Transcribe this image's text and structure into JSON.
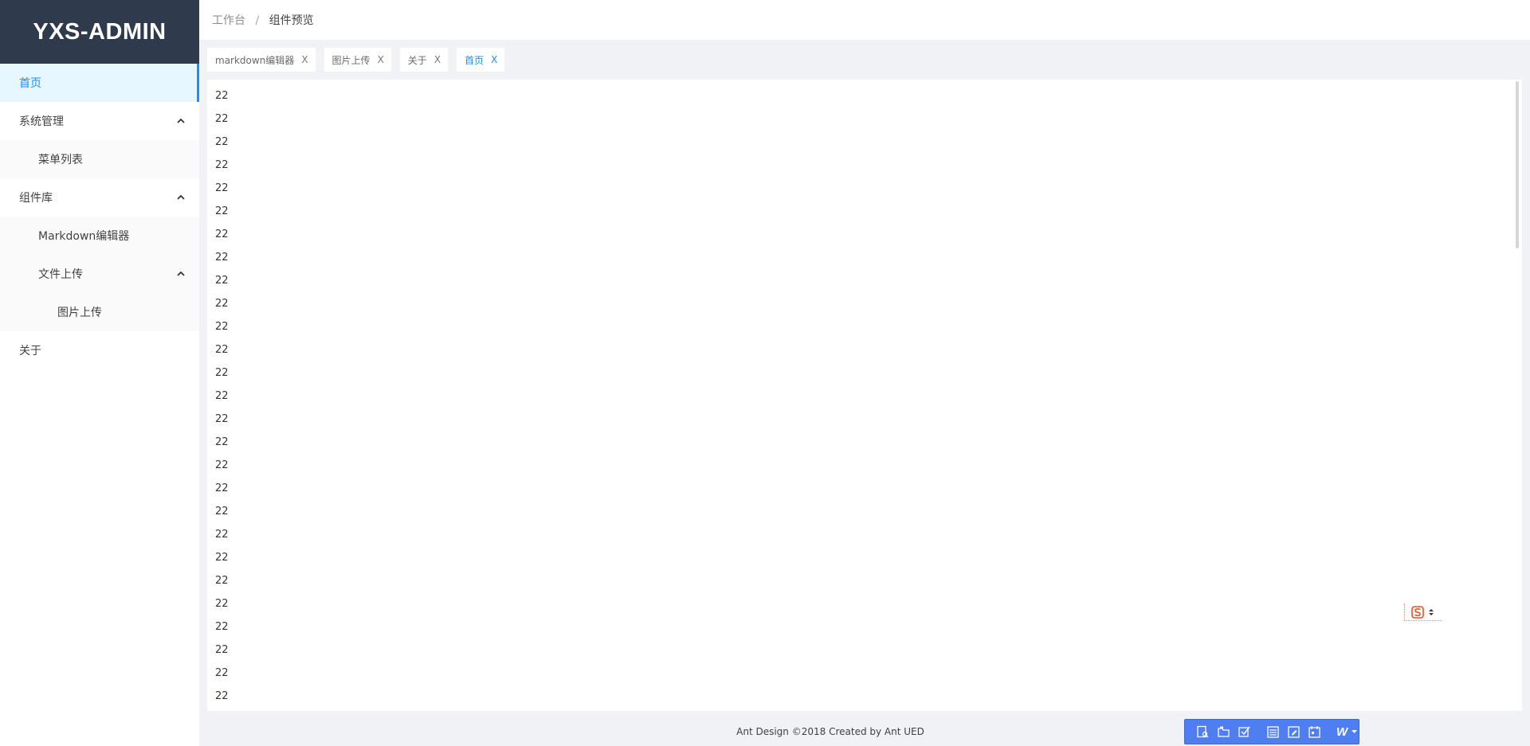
{
  "logo": {
    "text": "YXS-ADMIN"
  },
  "menu": {
    "home": "首页",
    "system": "系统管理",
    "menu_list": "菜单列表",
    "components": "组件库",
    "markdown": "Markdown编辑器",
    "file_upload": "文件上传",
    "image_upload": "图片上传",
    "about": "关于"
  },
  "breadcrumb": {
    "root": "工作台",
    "separator": "/",
    "current": "组件预览"
  },
  "tabs": [
    {
      "label": "markdown编辑器",
      "close": "X"
    },
    {
      "label": "图片上传",
      "close": "X"
    },
    {
      "label": "关于",
      "close": "X"
    },
    {
      "label": "首页",
      "close": "X"
    }
  ],
  "content": {
    "lines": [
      "22",
      "22",
      "22",
      "22",
      "22",
      "22",
      "22",
      "22",
      "22",
      "22",
      "22",
      "22",
      "22",
      "22",
      "22",
      "22",
      "22",
      "22",
      "22",
      "22",
      "22",
      "22",
      "22",
      "22",
      "22",
      "22",
      "22"
    ]
  },
  "footer": {
    "text": "Ant Design ©2018 Created by Ant UED"
  },
  "toolbar": {
    "w_label": "W"
  },
  "colors": {
    "primary": "#1890ff",
    "logo_bg": "#2f3a4d",
    "toolbar_bg": "#4e7ef2"
  }
}
